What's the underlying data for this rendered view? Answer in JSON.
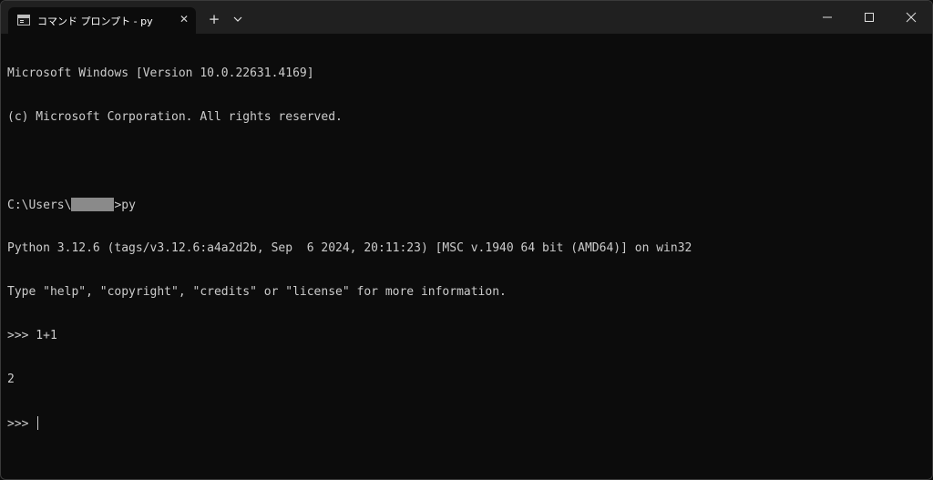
{
  "tab": {
    "title": "コマンド プロンプト - py",
    "icon": "terminal-icon",
    "close_icon": "close-icon"
  },
  "titlebar": {
    "new_tab_icon": "plus-icon",
    "dropdown_icon": "chevron-down-icon",
    "minimize_icon": "minimize-icon",
    "maximize_icon": "maximize-icon",
    "close_icon": "close-icon"
  },
  "terminal": {
    "line1": "Microsoft Windows [Version 10.0.22631.4169]",
    "line2": "(c) Microsoft Corporation. All rights reserved.",
    "line3": "",
    "prompt_prefix": "C:\\Users\\",
    "prompt_suffix": ">py",
    "line5": "Python 3.12.6 (tags/v3.12.6:a4a2d2b, Sep  6 2024, 20:11:23) [MSC v.1940 64 bit (AMD64)] on win32",
    "line6": "Type \"help\", \"copyright\", \"credits\" or \"license\" for more information.",
    "line7": ">>> 1+1",
    "line8": "2",
    "line9": ">>> "
  },
  "colors": {
    "background": "#0c0c0c",
    "titlebar": "#202020",
    "text": "#cccccc"
  }
}
